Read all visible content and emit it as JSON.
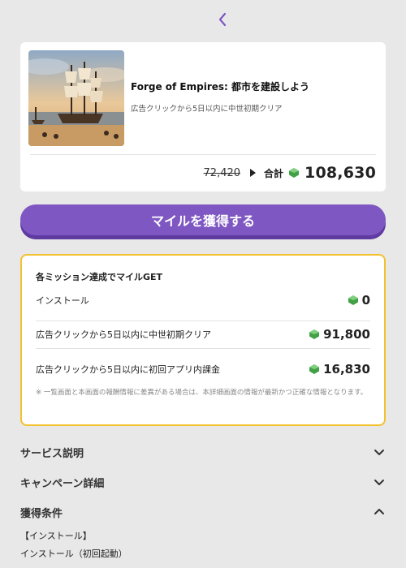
{
  "nav": {
    "back_icon": "chevron-left-icon"
  },
  "offer": {
    "title": "Forge of Empires: 都市を建設しよう",
    "subtitle": "広告クリックから5日以内に中世初期クリア",
    "image": "sailing-ship-harbor-image",
    "old_price": "72,420",
    "total_label": "合計",
    "total_value": "108,630"
  },
  "cta": {
    "label": "マイルを獲得する"
  },
  "missions": {
    "header": "各ミッション達成でマイルGET",
    "items": [
      {
        "label": "インストール",
        "value": "0"
      },
      {
        "label": "広告クリックから5日以内に中世初期クリア",
        "value": "91,800"
      },
      {
        "label": "広告クリックから5日以内に初回アプリ内課金",
        "value": "16,830"
      }
    ],
    "note": "※ 一覧画面と本画面の報酬情報に差異がある場合は、本詳細画面の情報が最新かつ正確な情報となります。"
  },
  "sections": [
    {
      "title": "サービス説明",
      "expanded": false
    },
    {
      "title": "キャンペーン詳細",
      "expanded": false
    },
    {
      "title": "獲得条件",
      "expanded": true
    }
  ],
  "conditions": {
    "line1": "【インストール】",
    "line2": "インストール（初回起動）"
  },
  "colors": {
    "accent": "#7e57c2",
    "border": "#f3c12e",
    "gem": "#4caf50"
  }
}
